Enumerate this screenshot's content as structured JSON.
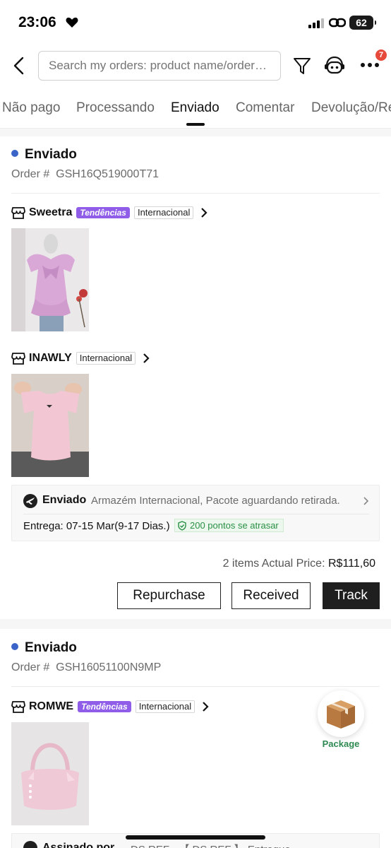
{
  "status_bar": {
    "time": "23:06",
    "battery": "62"
  },
  "search": {
    "placeholder": "Search my orders: product name/order…"
  },
  "header": {
    "more_badge": "7"
  },
  "tabs": [
    {
      "label": "Não pago"
    },
    {
      "label": "Processando"
    },
    {
      "label": "Enviado",
      "active": true
    },
    {
      "label": "Comentar"
    },
    {
      "label": "Devolução/Re"
    }
  ],
  "orders": [
    {
      "status": "Enviado",
      "order_label": "Order #",
      "order_number": "GSH16Q519000T71",
      "stores": [
        {
          "name": "Sweetra",
          "trend_badge": "Tendências",
          "tag": "Internacional",
          "product": "pink puff-sleeve blouse with bow"
        },
        {
          "name": "INAWLY",
          "tag": "Internacional",
          "product": "pink short-sleeve top"
        }
      ],
      "shipping": {
        "title": "Enviado",
        "description": "Armazém Internacional, Pacote aguardando retirada.",
        "delivery": "Entrega: 07-15 Mar(9-17 Dias.)",
        "points": "200 pontos se atrasar"
      },
      "summary": {
        "items": "2 items Actual Price:",
        "price": "R$111,60"
      },
      "buttons": {
        "repurchase": "Repurchase",
        "received": "Received",
        "track": "Track"
      }
    },
    {
      "status": "Enviado",
      "order_label": "Order #",
      "order_number": "GSH16051100N9MP",
      "stores": [
        {
          "name": "ROMWE",
          "trend_badge": "Tendências",
          "tag": "Internacional",
          "product": "pink shoulder bag with bows"
        }
      ],
      "shipping": {
        "title": "Assinado por",
        "description": "DS REF - 【 DS REF 】 Entregue"
      }
    }
  ],
  "package_widget": {
    "label": "Package"
  },
  "colors": {
    "status_dot": "#3b64c8",
    "trend_badge": "#8f5de8",
    "points_green": "#2a8f45",
    "badge_red": "#e64a3b"
  }
}
